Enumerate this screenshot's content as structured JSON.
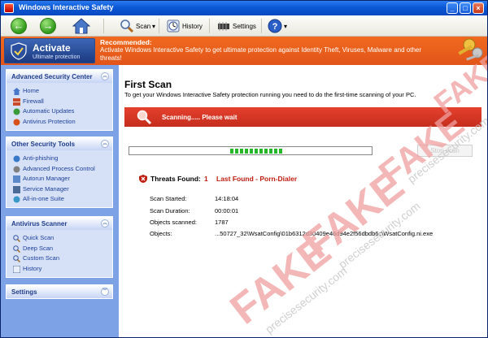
{
  "window": {
    "title": "Windows Interactive Safety"
  },
  "toolbar": {
    "scan_label": "Scan",
    "history_label": "History",
    "settings_label": "Settings"
  },
  "banner": {
    "activate_label": "Activate",
    "activate_sub": "Ultimate protection",
    "recommended_label": "Recommended:",
    "message": "Activate Windows Interactive Safety to get ultimate protection against Identity Theft, Viruses, Malware and other threats!"
  },
  "sidebar": {
    "advanced": {
      "title": "Advanced Security Center",
      "items": [
        "Home",
        "Firewall",
        "Automatic Updates",
        "Antivirus Protection"
      ]
    },
    "other": {
      "title": "Other Security Tools",
      "items": [
        "Anti-phishing",
        "Advanced Process Control",
        "Autorun Manager",
        "Service Manager",
        "All-in-one Suite"
      ]
    },
    "scanner": {
      "title": "Antivirus Scanner",
      "items": [
        "Quick Scan",
        "Deep Scan",
        "Custom Scan",
        "History"
      ]
    },
    "settings": {
      "title": "Settings"
    }
  },
  "main": {
    "title": "First Scan",
    "subtitle": "To get your Windows Interactive Safety protection running you need to do the first-time scanning of your PC.",
    "scan_status": "Scanning..... Please wait",
    "stop_label": "Stop scan",
    "progress_segments": 11,
    "threats_label": "Threats Found:",
    "threats_count": "1",
    "last_found": "Last Found - Porn-Dialer",
    "info": [
      {
        "key": "Scan Started:",
        "value": "14:18:04"
      },
      {
        "key": "Scan Duration:",
        "value": "00:00:01"
      },
      {
        "key": "Objects scanned:",
        "value": "1787"
      },
      {
        "key": "Objects:",
        "value": "...50727_32\\WsatConfig\\01b6312d30409e46d94e2f56dbdb6c\\WsatConfig.ni.exe"
      }
    ]
  },
  "watermark": {
    "fake": "FAKE",
    "site": "precisesecurity.com"
  },
  "colors": {
    "banner": "#e2541a",
    "scan_bar": "#d03020",
    "sidebar": "#7ea2e6",
    "watermark": "#f0a0a0"
  }
}
